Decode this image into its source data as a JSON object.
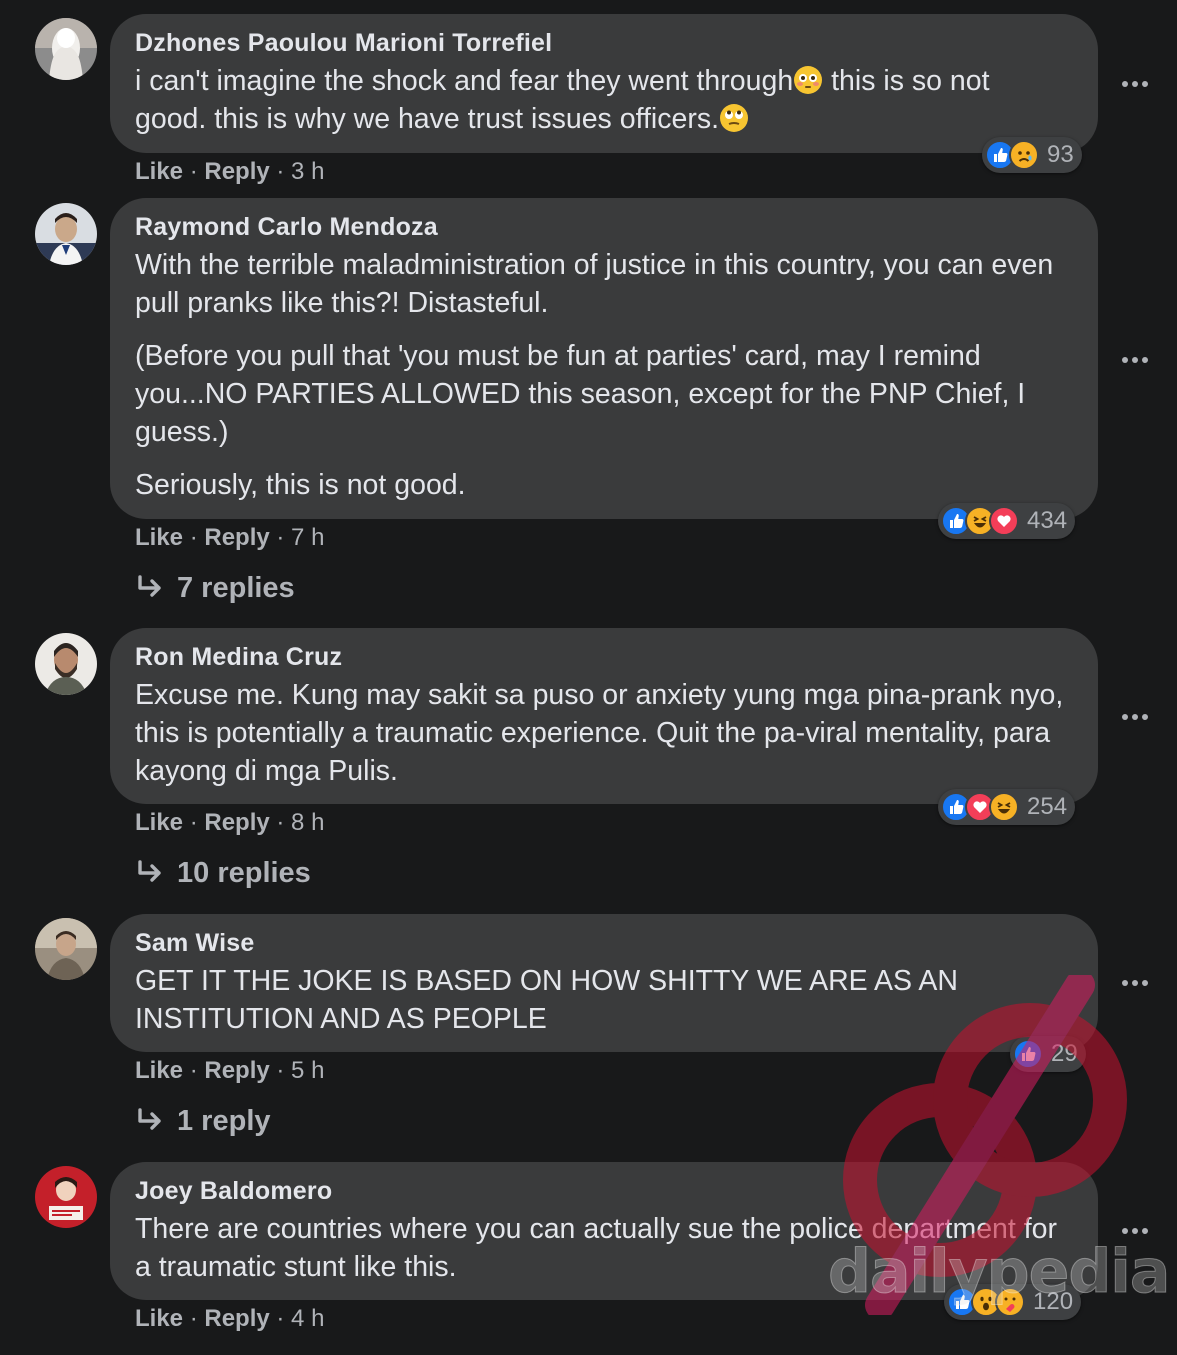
{
  "labels": {
    "like": "Like",
    "reply": "Reply",
    "sep": " · "
  },
  "comments": [
    {
      "author": "Dzhones Paoulou Marioni Torrefiel",
      "text_a": "i can't imagine the shock and fear they went through",
      "text_b": " this is so not good. this is why we have trust issues officers.",
      "emoji_a": "flushed-face",
      "emoji_b": "rolling-eyes-face",
      "time": "3 h",
      "reaction_icons": [
        "like",
        "sad"
      ],
      "reaction_count": "93"
    },
    {
      "author": "Raymond Carlo Mendoza",
      "paragraphs": [
        "With the terrible maladministration of justice in this country, you can even pull pranks like this?! Distasteful.",
        "(Before you pull that 'you must be fun at parties' card, may I remind you...NO PARTIES ALLOWED this season, except for the PNP Chief, I guess.)",
        "Seriously, this is not good."
      ],
      "time": "7 h",
      "reaction_icons": [
        "like",
        "haha",
        "love"
      ],
      "reaction_count": "434",
      "replies": "7 replies"
    },
    {
      "author": "Ron Medina Cruz",
      "text": "Excuse me. Kung may sakit sa puso or anxiety yung mga pina-prank nyo, this is potentially a traumatic experience. Quit the pa-viral mentality, para kayong di mga Pulis.",
      "time": "8 h",
      "reaction_icons": [
        "like",
        "love",
        "haha"
      ],
      "reaction_count": "254",
      "replies": "10 replies"
    },
    {
      "author": "Sam Wise",
      "text": "GET IT THE JOKE IS BASED ON HOW SHITTY WE ARE AS AN INSTITUTION AND AS PEOPLE",
      "time": "5 h",
      "reaction_icons": [
        "like"
      ],
      "reaction_count": "29",
      "replies": "1 reply"
    },
    {
      "author": "Joey Baldomero",
      "text": "There are countries where you can actually sue the police department for a traumatic stunt like this.",
      "time": "4 h",
      "reaction_icons": [
        "like",
        "wow",
        "care"
      ],
      "reaction_count": "120"
    }
  ],
  "watermark": {
    "text": "dailypedia",
    "logo": "dailypedia-logo"
  },
  "colors": {
    "background": "#18191a",
    "bubble": "#3a3b3c",
    "text": "#e4e6eb",
    "secondary": "#b0b3b8",
    "like": "#1877f2",
    "love": "#f33e58",
    "haha": "#f7b125",
    "watermark_red": "#c8102e"
  }
}
